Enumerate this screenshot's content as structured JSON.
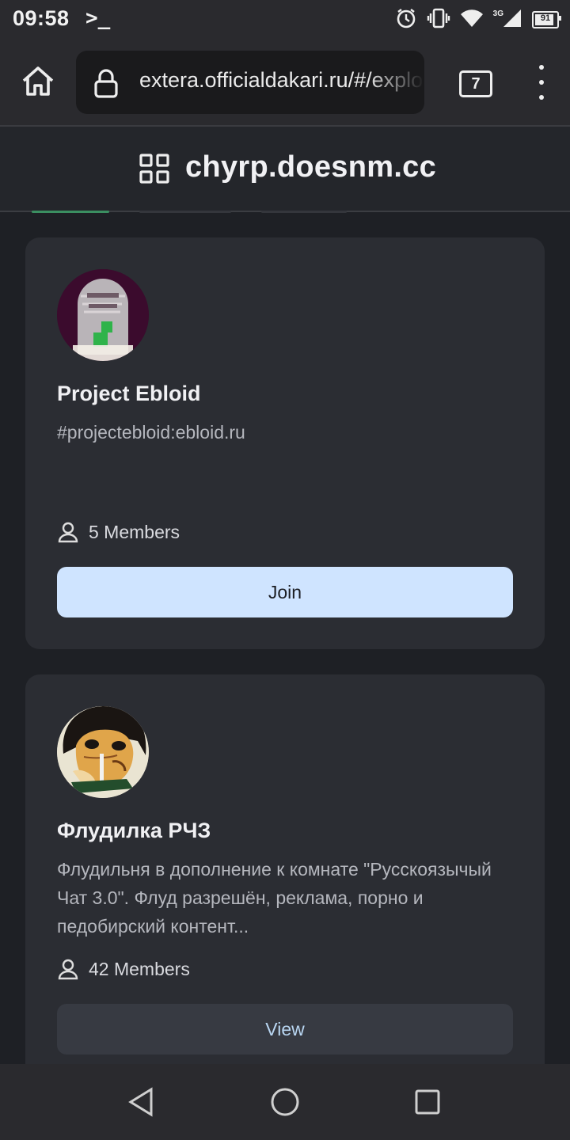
{
  "status_bar": {
    "time": "09:58",
    "terminal_glyph": ">_",
    "network": "3G",
    "battery": "91",
    "battery_level": 0.91
  },
  "browser": {
    "url": "extera.officialdakari.ru/#/explore",
    "tab_count": "7"
  },
  "site": {
    "title": "chyrp.doesnm.cc"
  },
  "rooms": [
    {
      "name": "Project Ebloid",
      "description": "#projectebloid:ebloid.ru",
      "members": "5 Members",
      "action": "Join",
      "avatar_icon": "gravestone-avatar-icon"
    },
    {
      "name": "Флудилка РЧЗ",
      "description": "Флудильня в дополнение к комнате \"Русскоязычый Чат 3.0\". Флуд разрешён, реклама, порно и педобирский контент...",
      "members": "42 Members",
      "action": "View",
      "avatar_icon": "cartoon-girl-avatar-icon"
    }
  ],
  "colors": {
    "background": "#1e2025",
    "card": "#2b2d33",
    "join_button": "#cfe4ff",
    "view_button": "#373a42",
    "accent_green": "#3b8f61"
  }
}
